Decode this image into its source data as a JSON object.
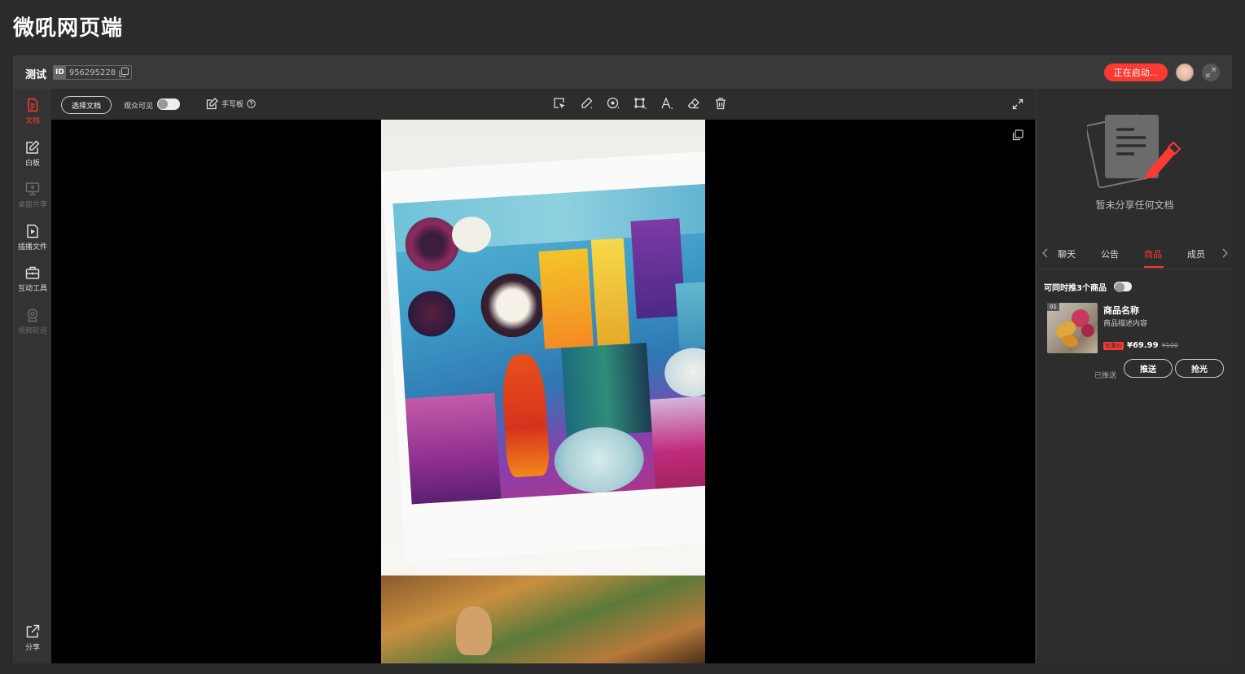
{
  "app": {
    "title": "微吼网页端"
  },
  "header": {
    "room_name": "测试",
    "id_tag": "ID",
    "room_id": "956295228",
    "start_button": "正在启动..."
  },
  "sidebar": {
    "items": [
      {
        "label": "文档",
        "icon": "document-icon",
        "state": "active"
      },
      {
        "label": "白板",
        "icon": "whiteboard-icon",
        "state": "normal"
      },
      {
        "label": "桌面共享",
        "icon": "desktop-share-icon",
        "state": "disabled"
      },
      {
        "label": "插播文件",
        "icon": "insert-file-icon",
        "state": "normal"
      },
      {
        "label": "互动工具",
        "icon": "toolbox-icon",
        "state": "normal"
      },
      {
        "label": "视频轮巡",
        "icon": "video-patrol-icon",
        "state": "disabled"
      }
    ],
    "share": {
      "label": "分享",
      "icon": "share-icon"
    }
  },
  "toolbar": {
    "select_doc": "选择文档",
    "audience_visible": "观众可见",
    "audience_visible_on": false,
    "handwriting": "手写板",
    "tools": [
      "select-icon",
      "pen-icon",
      "shape-icon",
      "rect-select-icon",
      "text-icon",
      "eraser-icon",
      "trash-icon"
    ]
  },
  "right_panel": {
    "empty_doc_text": "暂未分享任何文档",
    "tabs": [
      {
        "label": "聊天",
        "active": false
      },
      {
        "label": "公告",
        "active": false
      },
      {
        "label": "商品",
        "active": true
      },
      {
        "label": "成员",
        "active": false
      }
    ],
    "push_limit_label": "可同时推3个商品",
    "push_limit_on": false,
    "products": [
      {
        "index": "01",
        "name": "商品名称",
        "desc": "商品描述内容",
        "tag": "优惠价",
        "price": "¥69.99",
        "orig_price": "¥100",
        "pushed_label": "已推送",
        "push_button": "推送",
        "sold_out_button": "抢光"
      }
    ]
  },
  "colors": {
    "accent": "#fb3a32",
    "background": "#2b2b2b",
    "stage": "#000000"
  }
}
